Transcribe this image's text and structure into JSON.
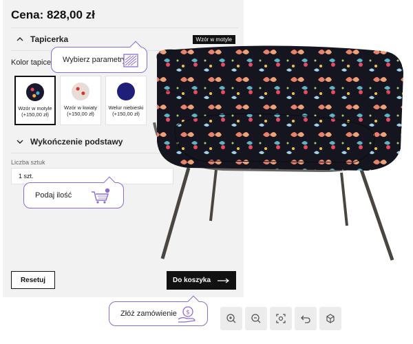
{
  "price_label": "Cena: 828,00 zł",
  "upholstery": {
    "title": "Tapicerka",
    "badge": "Wzór w motyle",
    "color_label": "Kolor tapicer",
    "swatches": [
      {
        "name": "Wzór w motyle",
        "extra": "(+150,00 zł)",
        "color": "#1a1a2e",
        "selected": true
      },
      {
        "name": "Wzór w kwiaty",
        "extra": "(+150,00 zł)",
        "color": "#e8dcd6",
        "selected": false
      },
      {
        "name": "Welur niebieski",
        "extra": "(+150,00 zł)",
        "color": "#1f1f7a",
        "selected": false
      }
    ]
  },
  "base_finish": {
    "title": "Wykończenie podstawy"
  },
  "quantity": {
    "label": "Liczba sztuk",
    "value": "1 szt."
  },
  "buttons": {
    "reset": "Resetuj",
    "cart": "Do koszyka"
  },
  "callouts": {
    "params": "Wybierz parametry",
    "qty": "Podaj ilość",
    "order": "Złóż zamówienie"
  },
  "viewer_tools": [
    "zoom-in-icon",
    "zoom-out-icon",
    "fit-view-icon",
    "undo-icon",
    "ar-cube-icon"
  ],
  "colors": {
    "accent": "#8a6bd6",
    "dark": "#111111"
  }
}
